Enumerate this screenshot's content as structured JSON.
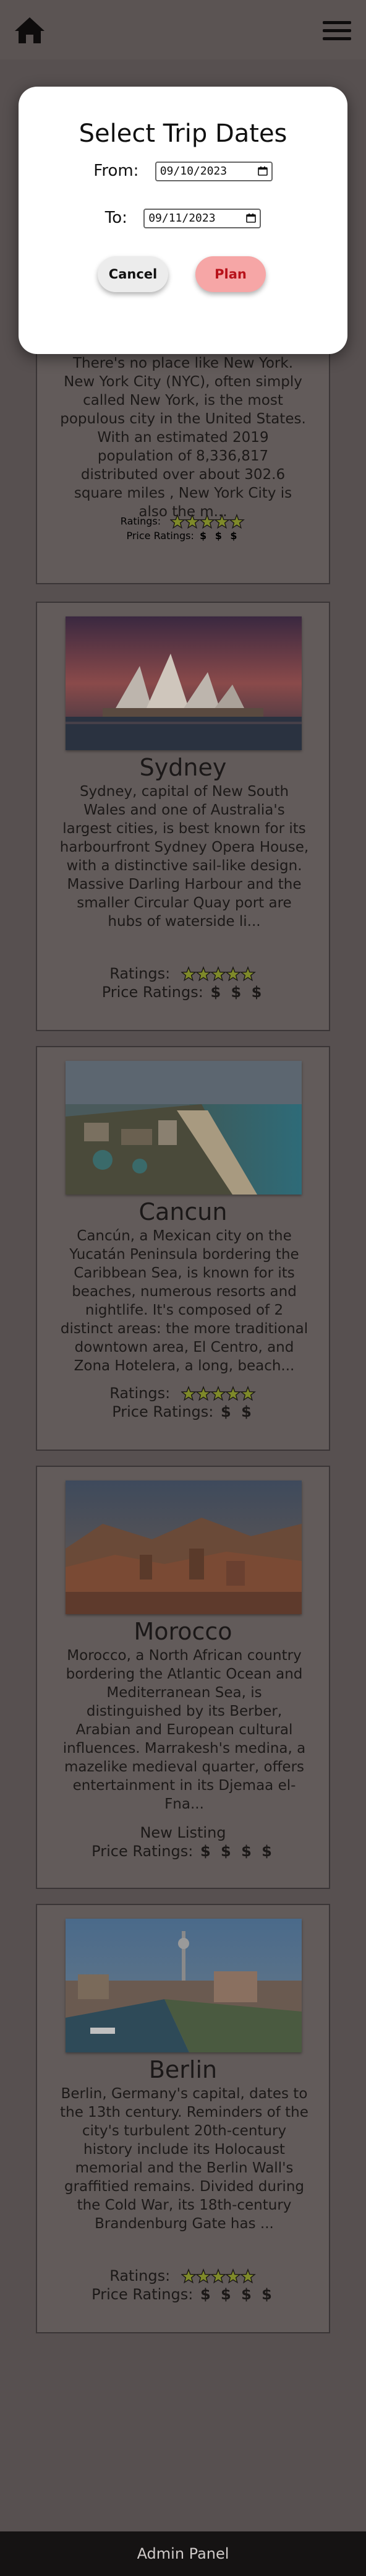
{
  "topbar": {
    "home_icon": "home-icon",
    "menu_icon": "hamburger-menu-icon"
  },
  "modal": {
    "title": "Select Trip Dates",
    "from_label": "From:",
    "from_value": "09/10/2023",
    "to_label": "To:",
    "to_value": "09/11/2023",
    "cancel_label": "Cancel",
    "plan_label": "Plan"
  },
  "destinations": [
    {
      "title": "",
      "description": "There's no place like New York. New York City (NYC), often simply called New York, is the most populous city in the United States. With an estimated 2019 population of 8,336,817 distributed over about 302.6 square miles , New York City is also the m...",
      "ratings_label": "Ratings:",
      "stars": 5,
      "price_label": "Price Ratings:",
      "price": "$ $ $"
    },
    {
      "title": "Sydney",
      "description": "Sydney, capital of New South Wales and one of Australia's largest cities, is best known for its harbourfront Sydney Opera House, with a distinctive sail-like design. Massive Darling Harbour and the smaller Circular Quay port are hubs of waterside li...",
      "ratings_label": "Ratings:",
      "stars": 5,
      "price_label": "Price Ratings:",
      "price": "$ $ $"
    },
    {
      "title": "Cancun",
      "description": "Cancún, a Mexican city on the Yucatán Peninsula bordering the Caribbean Sea, is known for its beaches, numerous resorts and nightlife. It's composed of 2 distinct areas: the more traditional downtown area, El Centro, and Zona Hotelera, a long, beach...",
      "ratings_label": "Ratings:",
      "stars": 5,
      "price_label": "Price Ratings:",
      "price": "$ $"
    },
    {
      "title": "Morocco",
      "description": "Morocco, a North African country bordering the Atlantic Ocean and Mediterranean Sea, is distinguished by its Berber, Arabian and European cultural influences. Marrakesh's medina, a mazelike medieval quarter, offers entertainment in its Djemaa el-Fna...",
      "ratings_label": "New Listing",
      "price_label": "Price Ratings:",
      "price": "$ $ $ $"
    },
    {
      "title": "Berlin",
      "description": "Berlin, Germany's capital, dates to the 13th century. Reminders of the city's turbulent 20th-century history include its Holocaust memorial and the Berlin Wall's graffitied remains. Divided during the Cold War, its 18th-century Brandenburg Gate has ...",
      "ratings_label": "Ratings:",
      "stars": 5,
      "price_label": "Price Ratings:",
      "price": "$ $ $ $"
    }
  ],
  "footer": {
    "label": "Admin Panel"
  },
  "colors": {
    "overlay_bg": "#575050",
    "plan_button_bg": "#f6a6a6",
    "plan_button_text": "#b8121a",
    "star_fill": "#7f8a2a"
  }
}
